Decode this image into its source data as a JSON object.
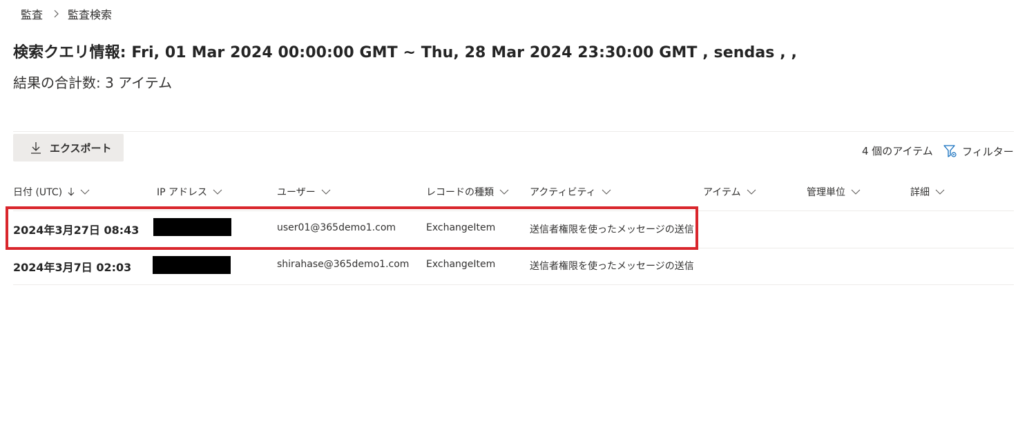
{
  "breadcrumb": {
    "parent": "監査",
    "current": "監査検索"
  },
  "query": {
    "title": "検索クエリ情報: Fri, 01 Mar 2024 00:00:00 GMT ~ Thu, 28 Mar 2024 23:30:00 GMT , sendas , ,",
    "result_count": "結果の合計数: 3 アイテム"
  },
  "toolbar": {
    "export_label": "エクスポート",
    "item_count": "4 個のアイテム",
    "filter_label": "フィルター"
  },
  "table": {
    "columns": [
      {
        "label": "日付 (UTC)",
        "sorted": "desc"
      },
      {
        "label": "IP アドレス"
      },
      {
        "label": "ユーザー"
      },
      {
        "label": "レコードの種類"
      },
      {
        "label": "アクティビティ"
      },
      {
        "label": "アイテム"
      },
      {
        "label": "管理単位"
      },
      {
        "label": "詳細"
      }
    ],
    "rows": [
      {
        "date": "2024年3月27日 08:43",
        "ip": "",
        "user": "user01@365demo1.com",
        "record_type": "ExchangeItem",
        "activity": "送信者権限を使ったメッセージの送信",
        "item": "",
        "admin_unit": "",
        "detail": "",
        "highlighted": true
      },
      {
        "date": "2024年3月7日 02:03",
        "ip": "",
        "user": "shirahase@365demo1.com",
        "record_type": "ExchangeItem",
        "activity": "送信者権限を使ったメッセージの送信",
        "item": "",
        "admin_unit": "",
        "detail": "",
        "highlighted": false
      }
    ]
  },
  "colors": {
    "highlight": "#d9262c",
    "redaction": "#000000",
    "button_bg": "#edebe9"
  }
}
